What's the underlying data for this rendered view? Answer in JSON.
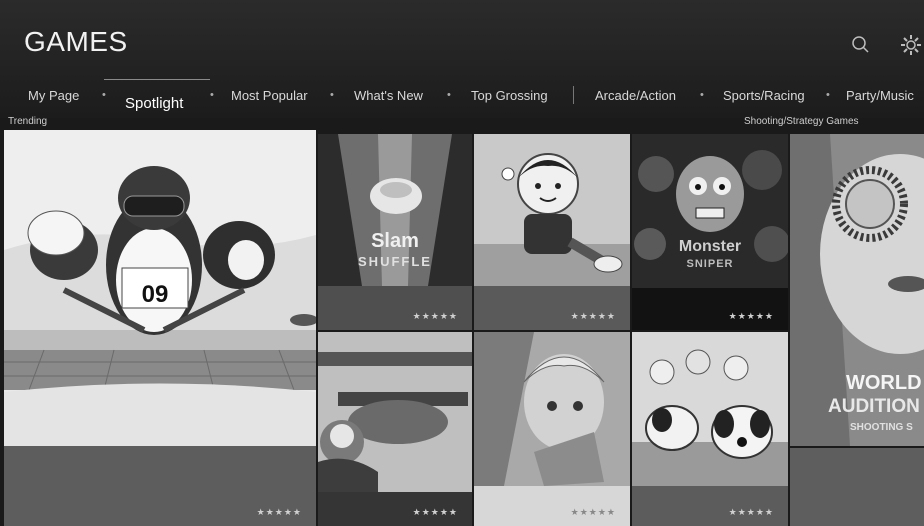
{
  "header": {
    "title": "GAMES",
    "icons": [
      "search-icon",
      "gear-icon"
    ]
  },
  "nav": {
    "items": [
      {
        "label": "My Page"
      },
      {
        "label": "Spotlight",
        "active": true
      },
      {
        "label": "Most Popular"
      },
      {
        "label": "What's New"
      },
      {
        "label": "Top Grossing"
      },
      {
        "label": "Arcade/Action"
      },
      {
        "label": "Sports/Racing"
      },
      {
        "label": "Party/Music"
      }
    ],
    "dot": "•"
  },
  "sections": {
    "left": "Trending",
    "right": "Shooting/Strategy Games"
  },
  "tiles": [
    {
      "id": "hero",
      "bib": "09",
      "rating": "★★★★★"
    },
    {
      "id": "slam-shuffle",
      "title": "Slam",
      "subtitle": "SHUFFLE",
      "rating": "★★★★★"
    },
    {
      "id": "boy-kicking",
      "rating": "★★★★★"
    },
    {
      "id": "monster-sniper",
      "title": "Monster",
      "subtitle": "SNIPER",
      "rating": "★★★★★"
    },
    {
      "id": "world-audition",
      "title": "WORLD",
      "subtitle": "AUDITION",
      "tagline": "SHOOTING S"
    },
    {
      "id": "biplane",
      "rating": "★★★★★"
    },
    {
      "id": "anime-girl",
      "rating": "★★★★★"
    },
    {
      "id": "puppies",
      "rating": "★★★★★"
    }
  ],
  "colors": {
    "background": "#1a1a1a",
    "topbar": "#232323",
    "tileFooter": "#555555"
  }
}
